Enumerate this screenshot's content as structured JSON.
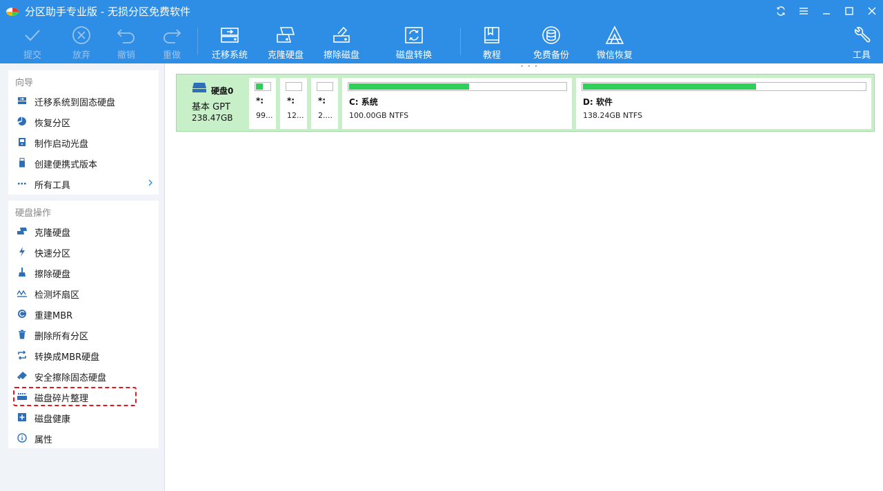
{
  "window": {
    "title": "分区助手专业版 - 无损分区免费软件"
  },
  "toolbar": {
    "submit": "提交",
    "discard": "放弃",
    "undo": "撤销",
    "redo": "重做",
    "migrate_os": "迁移系统",
    "clone_disk": "克隆硬盘",
    "wipe_disk": "擦除磁盘",
    "disk_convert": "磁盘转换",
    "tutorial": "教程",
    "free_backup": "免费备份",
    "wechat_recovery": "微信恢复",
    "tools": "工具"
  },
  "wizard": {
    "title": "向导",
    "items": [
      {
        "label": "迁移系统到固态硬盘",
        "icon": "migrate-icon"
      },
      {
        "label": "恢复分区",
        "icon": "recover-pie-icon"
      },
      {
        "label": "制作启动光盘",
        "icon": "bootable-media-icon"
      },
      {
        "label": "创建便携式版本",
        "icon": "usb-icon"
      },
      {
        "label": "所有工具",
        "icon": "more-dots-icon"
      }
    ]
  },
  "disk_ops": {
    "title": "硬盘操作",
    "items": [
      {
        "label": "克隆硬盘",
        "icon": "clone-icon"
      },
      {
        "label": "快速分区",
        "icon": "lightning-icon"
      },
      {
        "label": "擦除硬盘",
        "icon": "brush-icon"
      },
      {
        "label": "检测坏扇区",
        "icon": "wave-icon"
      },
      {
        "label": "重建MBR",
        "icon": "rebuild-icon"
      },
      {
        "label": "删除所有分区",
        "icon": "trash-icon"
      },
      {
        "label": "转换成MBR硬盘",
        "icon": "convert-icon"
      },
      {
        "label": "安全擦除固态硬盘",
        "icon": "eraser-icon"
      },
      {
        "label": "磁盘碎片整理",
        "icon": "defrag-icon"
      },
      {
        "label": "磁盘健康",
        "icon": "health-plus-icon"
      },
      {
        "label": "属性",
        "icon": "info-icon"
      }
    ]
  },
  "disk": {
    "name": "硬盘0",
    "type": "基本 GPT",
    "size": "238.47GB",
    "partitions": [
      {
        "name": "*:",
        "info": "99...",
        "used": 0.45
      },
      {
        "name": "*:",
        "info": "12...",
        "used": 0.0
      },
      {
        "name": "*:",
        "info": "2....",
        "used": 0.0
      },
      {
        "name": "C: 系统",
        "info": "100.00GB NTFS",
        "used": 0.55
      },
      {
        "name": "D: 软件",
        "info": "138.24GB NTFS",
        "used": 0.61
      }
    ]
  },
  "colors": {
    "accent": "#2e8de4",
    "disk_bg": "#c7f0c9",
    "used_bar": "#2fcf5a",
    "highlight": "#e8141c"
  }
}
